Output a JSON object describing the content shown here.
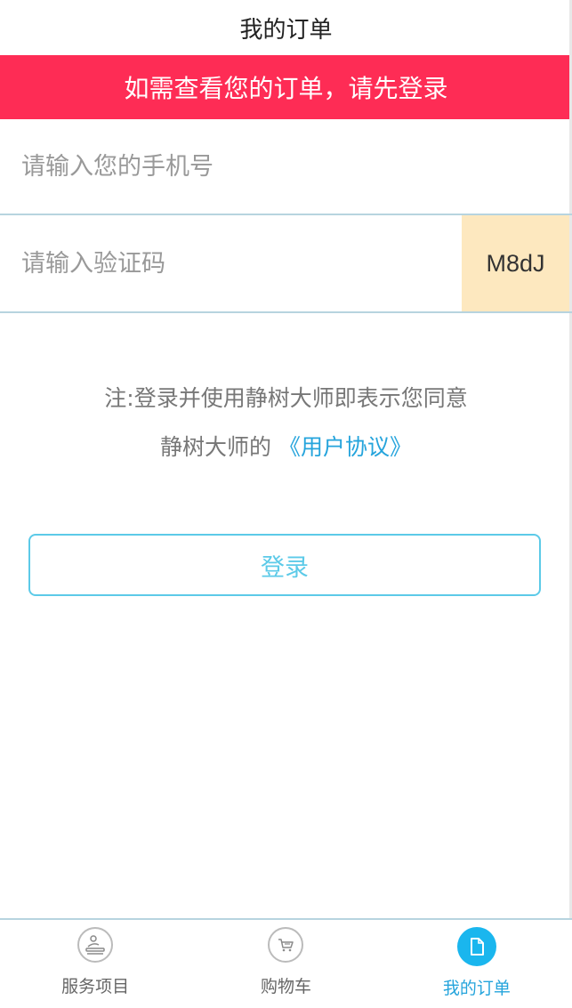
{
  "header": {
    "title": "我的订单"
  },
  "banner": {
    "text": "如需查看您的订单，请先登录"
  },
  "form": {
    "phone_placeholder": "请输入您的手机号",
    "code_placeholder": "请输入验证码",
    "captcha": "M8dJ"
  },
  "note": {
    "line1": "注:登录并使用静树大师即表示您同意",
    "line2_prefix": "静树大师的",
    "agreement_link": "《用户协议》"
  },
  "login_button": "登录",
  "tabbar": {
    "items": [
      {
        "label": "服务项目",
        "icon": "massage-service-icon",
        "active": false
      },
      {
        "label": "购物车",
        "icon": "cart-icon",
        "active": false
      },
      {
        "label": "我的订单",
        "icon": "document-icon",
        "active": true
      }
    ]
  },
  "colors": {
    "banner": "#fe2c55",
    "accent": "#25a4dc",
    "captcha_bg": "#fde8bf",
    "button_border": "#5ccae8"
  }
}
